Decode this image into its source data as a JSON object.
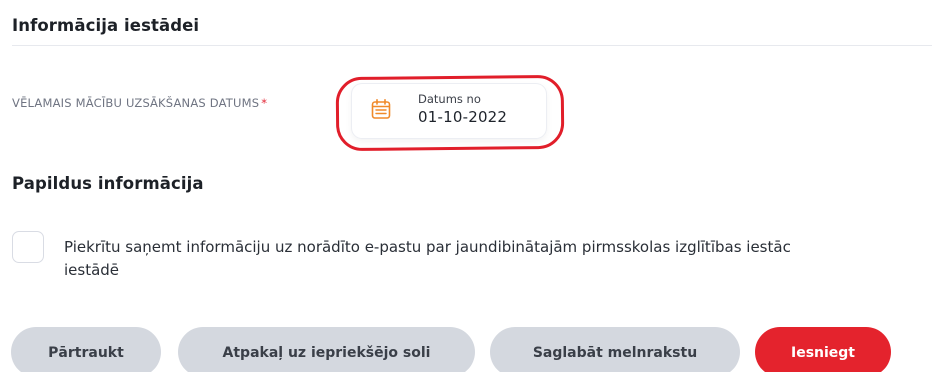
{
  "section_institution": {
    "title": "Informācija iestādei",
    "date_field": {
      "label": "VĒLAMAIS MĀCĪBU UZSĀKŠANAS DATUMS",
      "required_mark": "*",
      "caption": "Datums no",
      "value": "01-10-2022",
      "icon": "calendar-icon"
    }
  },
  "section_additional": {
    "title": "Papildus informācija",
    "consent": {
      "checked": false,
      "line1": "Piekrītu saņemt informāciju uz norādīto e-pastu par jaundibinātajām pirmsskolas izglītības iestāc",
      "line2": "iestādē"
    }
  },
  "actions": {
    "cancel_label": "Pārtraukt",
    "back_label": "Atpakaļ uz iepriekšējo soli",
    "draft_label": "Saglabāt melnrakstu",
    "submit_label": "Iesniegt"
  },
  "colors": {
    "accent_red": "#e4232d",
    "highlight_ring": "#e11e2a",
    "calendar_icon": "#f08a2a",
    "secondary_button": "#d4d8df"
  }
}
